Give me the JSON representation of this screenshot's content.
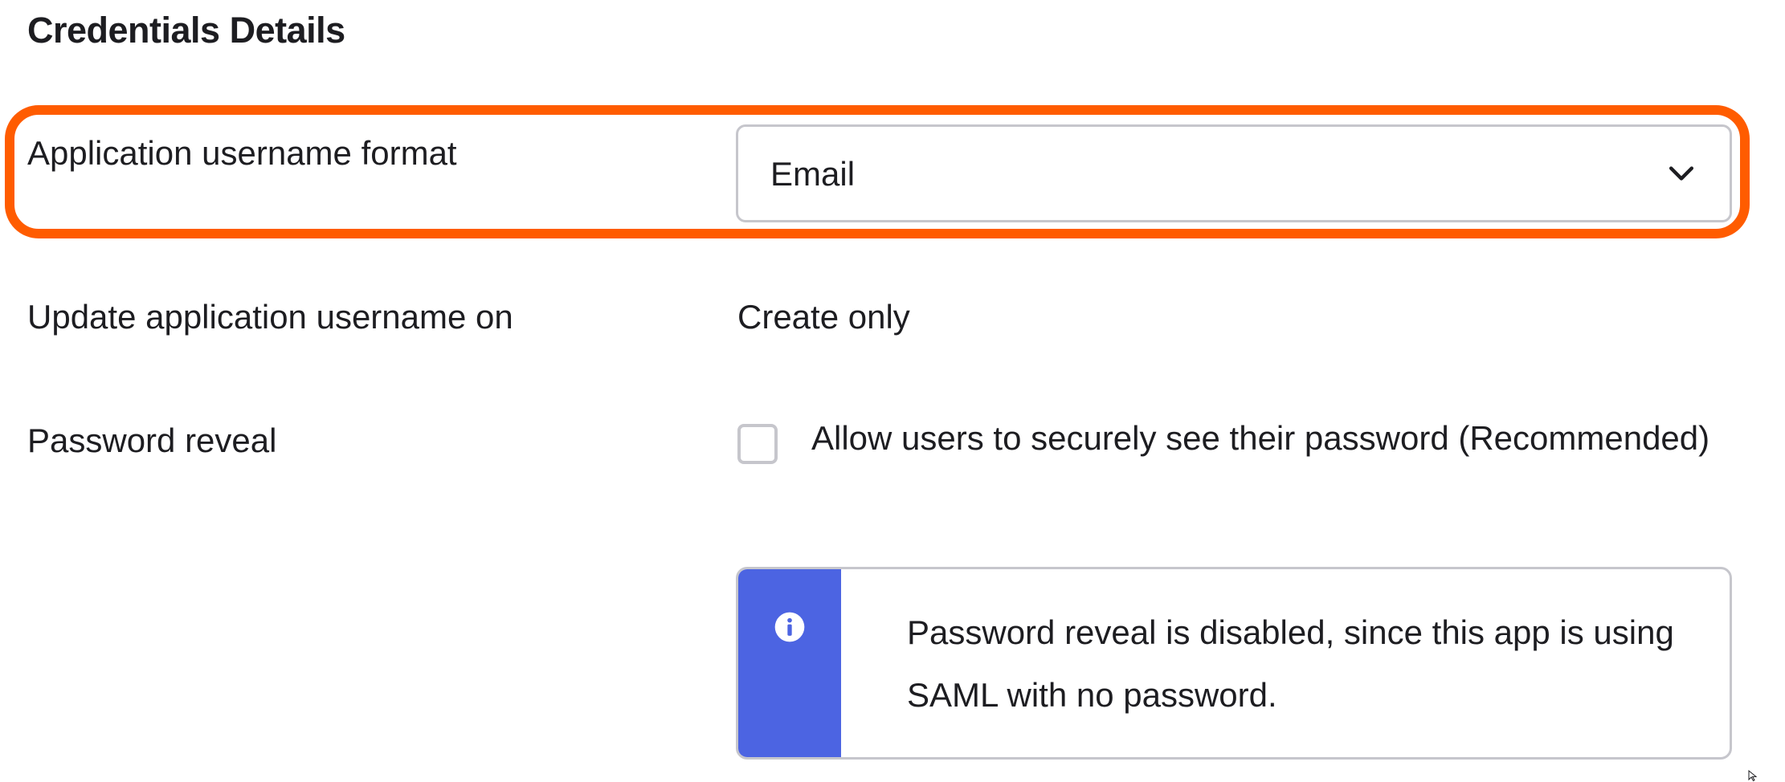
{
  "section": {
    "title": "Credentials Details"
  },
  "rows": {
    "username_format": {
      "label": "Application username format",
      "select_value": "Email",
      "dropdown_icon": "chevron-down-icon"
    },
    "update_username": {
      "label": "Update application username on",
      "value": "Create only"
    },
    "password_reveal": {
      "label": "Password reveal",
      "checkbox_label": "Allow users to securely see their password (Recommended)",
      "checked": false
    }
  },
  "callout": {
    "icon": "info-icon",
    "message": "Password reveal is disabled, since this app is using SAML with no password."
  },
  "colors": {
    "highlight": "#ff5c00",
    "callout_accent": "#4c64e2",
    "border": "#c6c6cc",
    "text": "#1d1d21"
  }
}
